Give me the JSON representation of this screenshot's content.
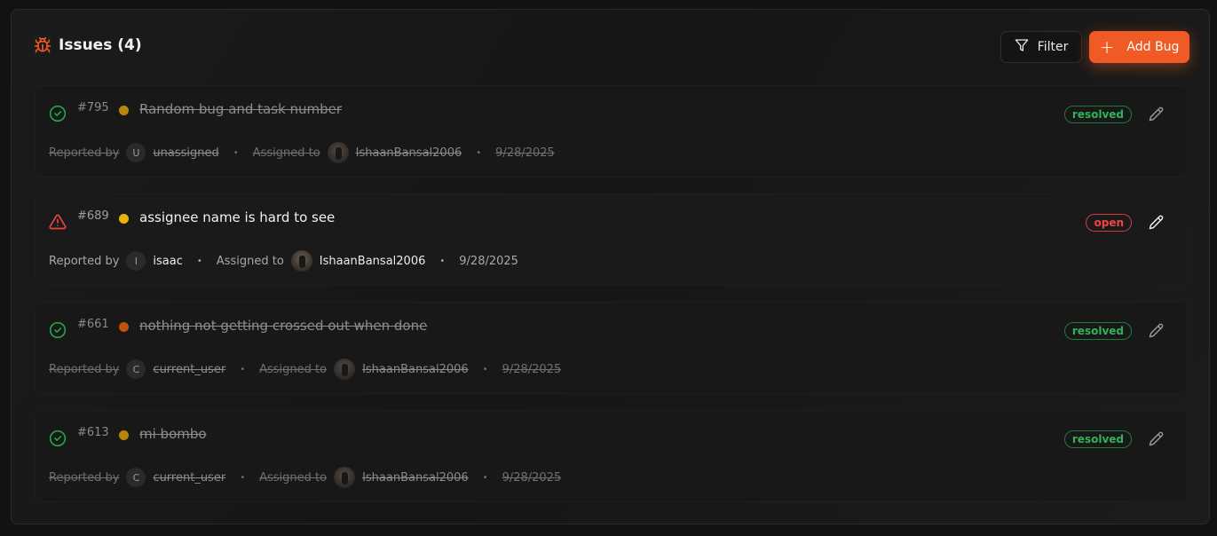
{
  "header": {
    "title": "Issues (4)",
    "filter_label": "Filter",
    "add_label": "Add Bug",
    "accent_color": "#f05a24"
  },
  "labels": {
    "reported_by": "Reported by",
    "assigned_to": "Assigned to",
    "separator": "•"
  },
  "issues": [
    {
      "number": "#795",
      "title": "Random bug and task number",
      "status": "resolved",
      "status_icon": "check-circle-icon",
      "priority_color": "#b8860b",
      "reporter_initial": "U",
      "reporter": "unassigned",
      "assignee": "IshaanBansal2006",
      "date": "9/28/2025"
    },
    {
      "number": "#689",
      "title": "assignee name is hard to see",
      "status": "open",
      "status_icon": "warning-triangle-icon",
      "priority_color": "#eab308",
      "reporter_initial": "I",
      "reporter": "isaac",
      "assignee": "IshaanBansal2006",
      "date": "9/28/2025"
    },
    {
      "number": "#661",
      "title": "nothing not getting crossed out when done",
      "status": "resolved",
      "status_icon": "check-circle-icon",
      "priority_color": "#c2520c",
      "reporter_initial": "C",
      "reporter": "current_user",
      "assignee": "IshaanBansal2006",
      "date": "9/28/2025"
    },
    {
      "number": "#613",
      "title": "mi bombo",
      "status": "resolved",
      "status_icon": "check-circle-icon",
      "priority_color": "#b8860b",
      "reporter_initial": "C",
      "reporter": "current_user",
      "assignee": "IshaanBansal2006",
      "date": "9/28/2025"
    }
  ]
}
